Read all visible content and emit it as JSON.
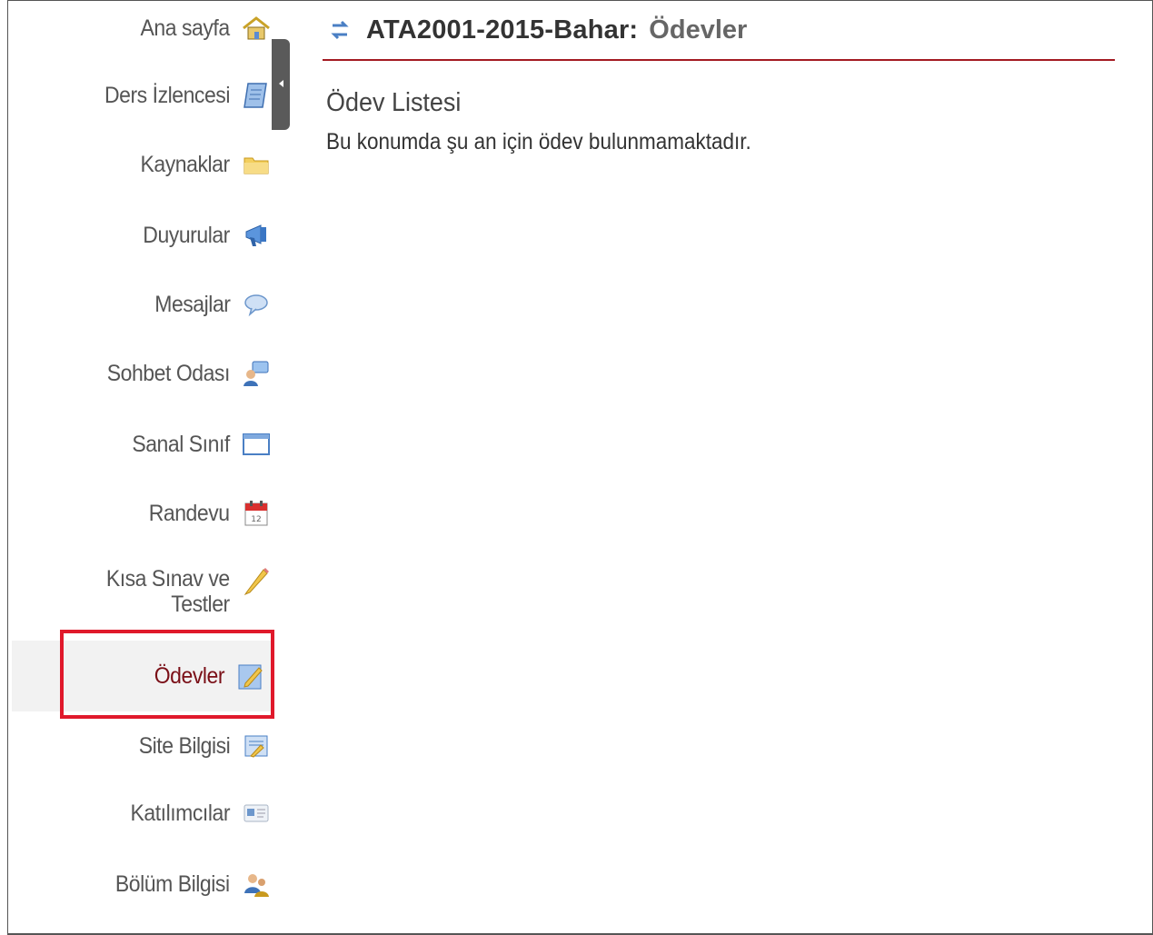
{
  "sidebar": {
    "items": [
      {
        "label": "Ana sayfa",
        "icon": "home-icon"
      },
      {
        "label": "Ders İzlencesi",
        "icon": "syllabus-icon"
      },
      {
        "label": "Kaynaklar",
        "icon": "folder-icon"
      },
      {
        "label": "Duyurular",
        "icon": "announcement-icon"
      },
      {
        "label": "Mesajlar",
        "icon": "message-bubble-icon"
      },
      {
        "label": "Sohbet Odası",
        "icon": "chat-room-icon"
      },
      {
        "label": "Sanal Sınıf",
        "icon": "window-icon"
      },
      {
        "label": "Randevu",
        "icon": "calendar-icon"
      },
      {
        "label": "Kısa Sınav ve Testler",
        "label_line1": "Kısa Sınav ve",
        "label_line2": "Testler",
        "icon": "pencil-icon"
      },
      {
        "label": "Ödevler",
        "icon": "assignment-icon",
        "active": true
      },
      {
        "label": "Site Bilgisi",
        "icon": "site-info-icon"
      },
      {
        "label": "Katılımcılar",
        "icon": "id-card-icon"
      },
      {
        "label": "Bölüm Bilgisi",
        "icon": "section-info-icon"
      }
    ]
  },
  "header": {
    "site_title": "ATA2001-2015-Bahar:",
    "tool_title": "Ödevler"
  },
  "main": {
    "section_title": "Ödev Listesi",
    "empty_message": "Bu konumda şu an için ödev bulunmamaktadır."
  },
  "colors": {
    "accent_line": "#a31a22",
    "active_text": "#7a0f17",
    "highlight_box": "#e0192b"
  }
}
